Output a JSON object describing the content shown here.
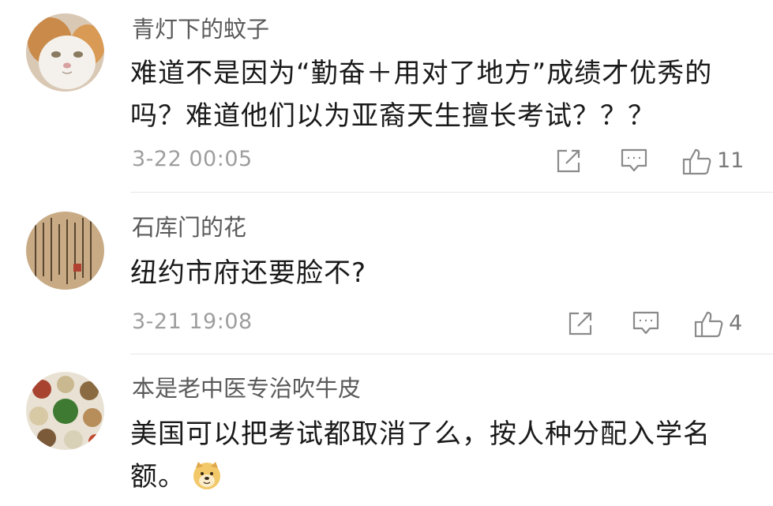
{
  "comments": [
    {
      "username": "青灯下的蚊子",
      "lines": [
        "难道不是因为“勤奋＋用对了地方”成绩才优秀的",
        "吗？难道他们以为亚裔天生擅长考试？？？"
      ],
      "time": "3-22 00:05",
      "likes": "11",
      "avatar_icon": "cat-avatar-icon"
    },
    {
      "username": "石库门的花",
      "lines": [
        "纽约市府还要脸不?"
      ],
      "time": "3-21 19:08",
      "likes": "4",
      "avatar_icon": "calligraphy-avatar-icon"
    },
    {
      "username": "本是老中医专治吹牛皮",
      "lines": [
        "美国可以把考试都取消了么，按人种分配入学名",
        "额。"
      ],
      "emoji": "doge-emoji-icon",
      "avatar_icon": "herbs-avatar-icon"
    }
  ],
  "colors": {
    "username": "#5a5a5a",
    "body_text": "#1a1a1a",
    "meta": "#9e9e9e",
    "icon": "#8a8a8a",
    "divider": "#e6e6e6"
  }
}
